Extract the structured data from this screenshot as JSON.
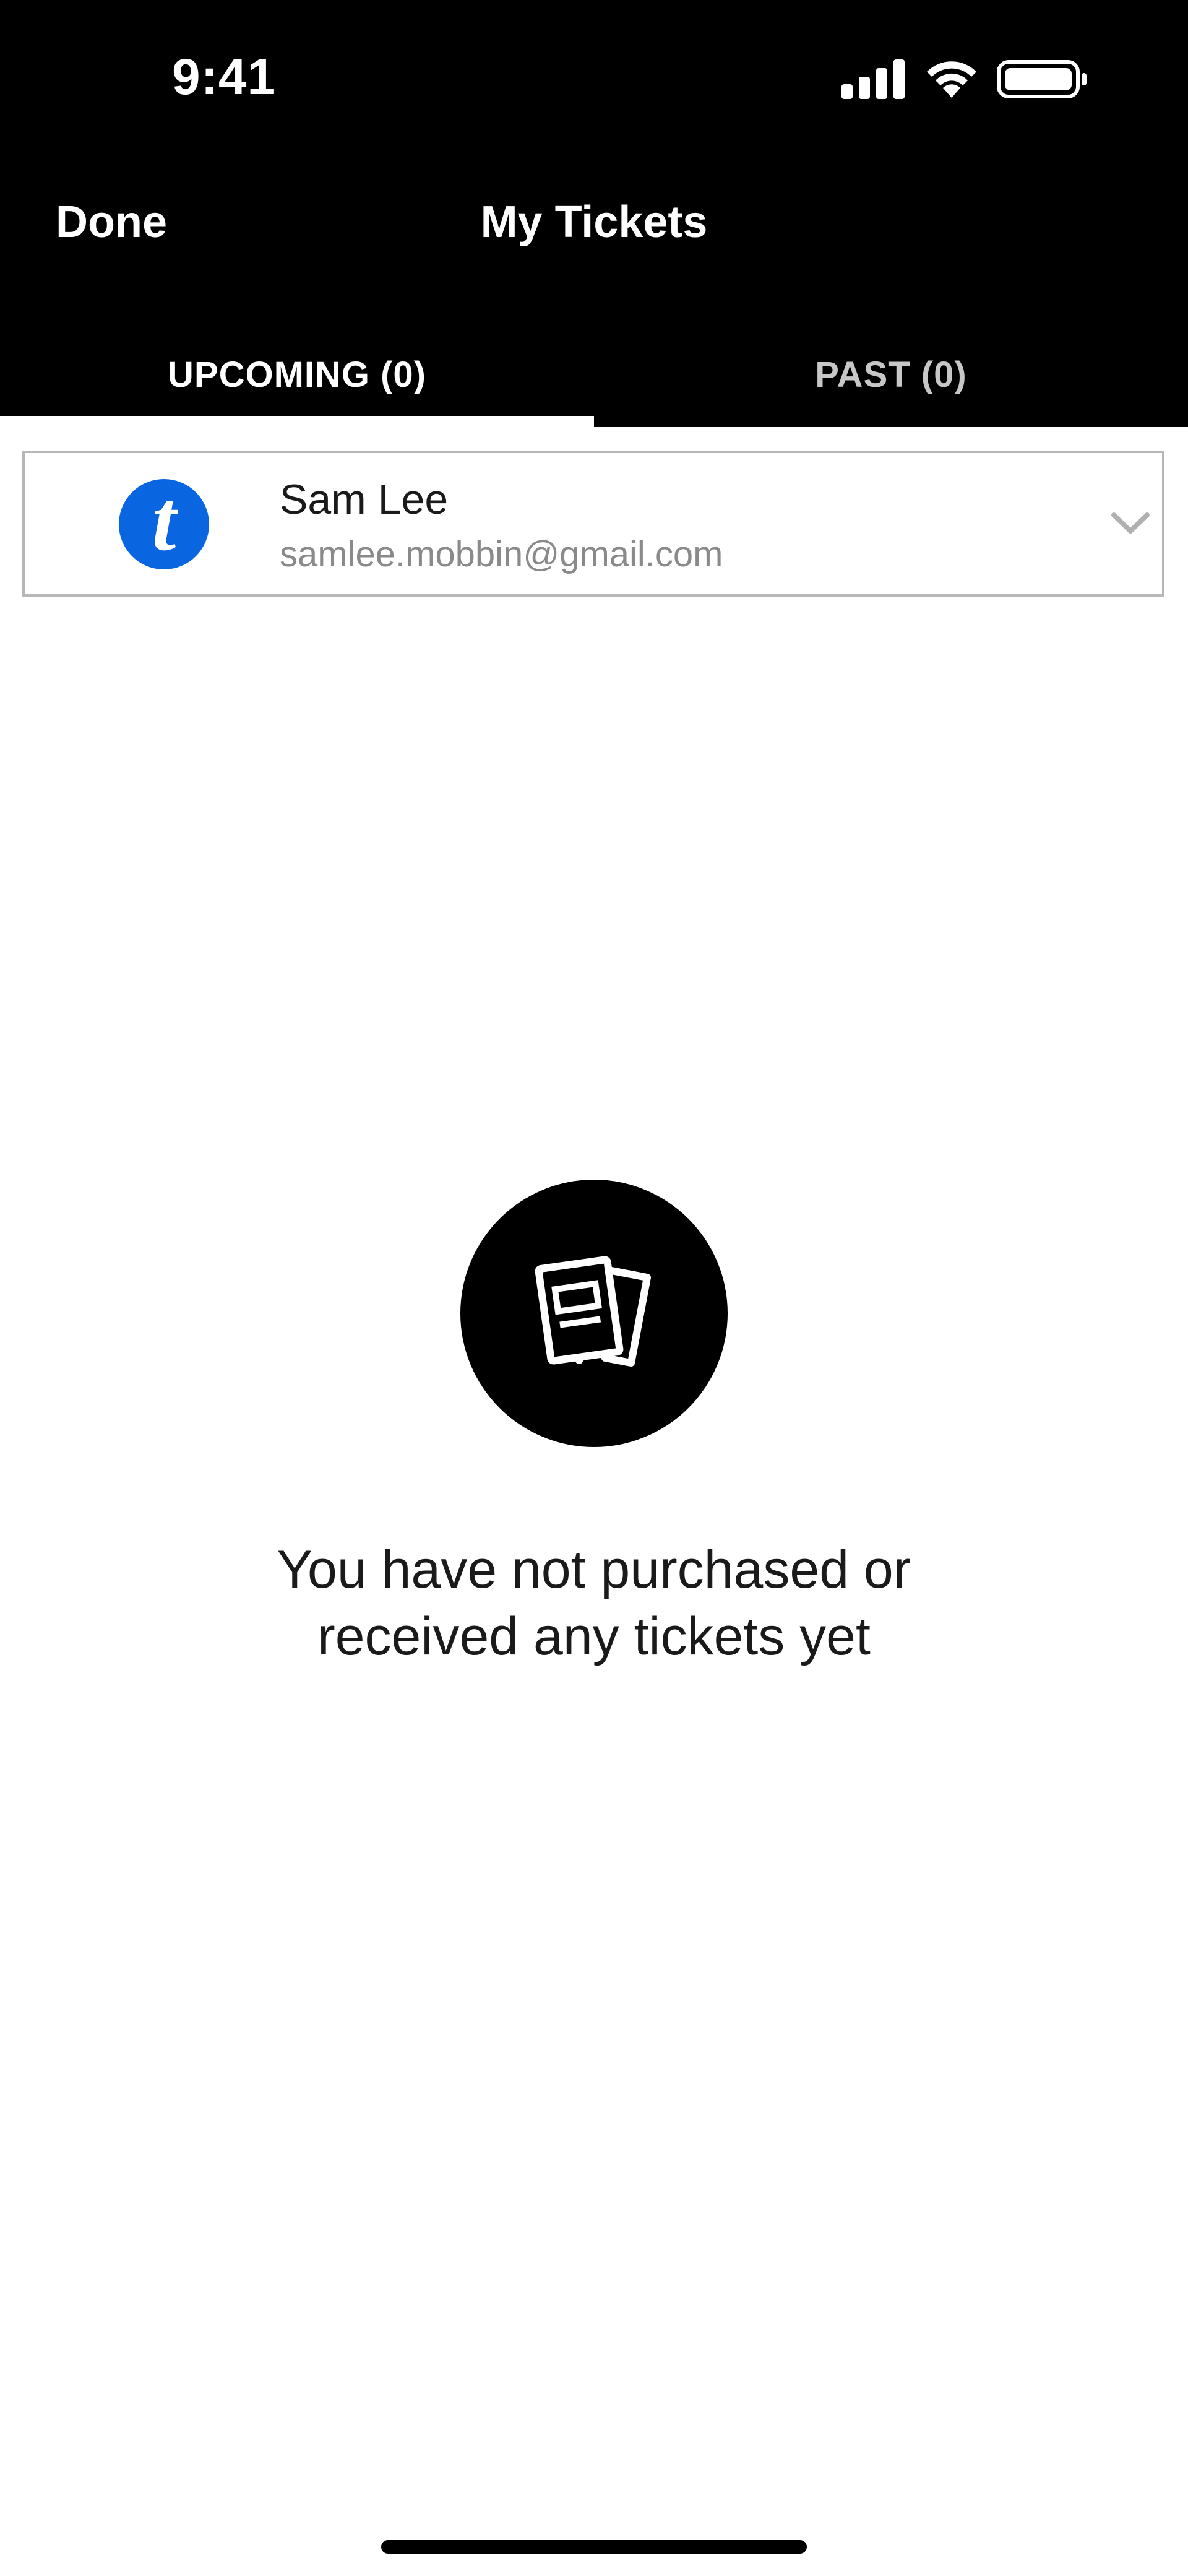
{
  "status_bar": {
    "time": "9:41",
    "icons": [
      "signal-icon",
      "wifi-icon",
      "battery-icon"
    ]
  },
  "header": {
    "done_label": "Done",
    "title": "My Tickets"
  },
  "tabs": [
    {
      "label": "UPCOMING (0)",
      "selected": true
    },
    {
      "label": "PAST (0)",
      "selected": false
    }
  ],
  "account": {
    "logo_letter": "t",
    "name": "Sam Lee",
    "email": "samlee.mobbin@gmail.com",
    "logo_color": "#0a66e0"
  },
  "empty_state": {
    "icon": "tickets-icon",
    "line1": "You have not purchased or",
    "line2": "received any tickets yet"
  },
  "colors": {
    "header_bg": "#000000",
    "accent_blue": "#0a66e0",
    "inactive_tab": "#c7c7c7"
  }
}
